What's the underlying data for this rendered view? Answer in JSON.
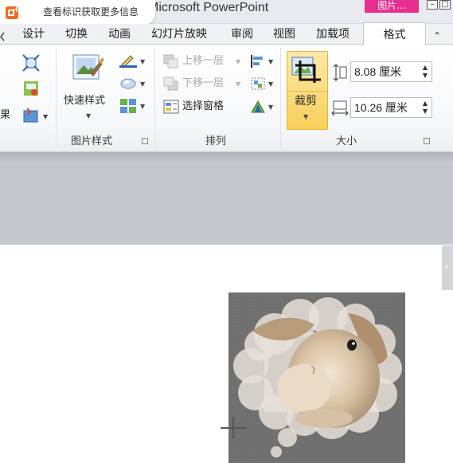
{
  "window": {
    "title": "Microsoft PowerPoint",
    "context_tab": "图片...",
    "minimize_glyph": "–",
    "restore_glyph": "□"
  },
  "tooltip": {
    "text": "查看标识获取更多信息"
  },
  "tabs": {
    "items": [
      "设计",
      "切换",
      "动画",
      "幻灯片放映",
      "审阅",
      "视图",
      "加载项"
    ],
    "active": "格式",
    "collapse_glyph": "⌃"
  },
  "ribbon": {
    "left_partial_label": "果",
    "picture_styles": {
      "quick_styles_label": "快速样式",
      "group_label": "图片样式"
    },
    "arrange": {
      "bring_forward": "上移一层",
      "send_backward": "下移一层",
      "selection_pane": "选择窗格",
      "group_label": "排列"
    },
    "size": {
      "crop_label": "裁剪",
      "height_value": "8.08 厘米",
      "width_value": "10.26 厘米",
      "group_label": "大小"
    }
  },
  "colors": {
    "accent": "#e62f8e",
    "crop_button": "#f8cf5a",
    "band": "#c4c7cc"
  }
}
